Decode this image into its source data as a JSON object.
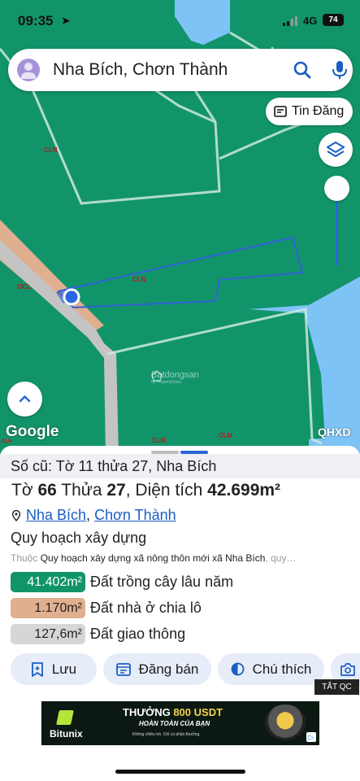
{
  "status_bar": {
    "time": "09:35",
    "network": "4G",
    "battery": "74"
  },
  "search": {
    "value": "Nha Bích, Chơn Thành"
  },
  "map": {
    "tin_dang_label": "Tin Đăng",
    "labels": {
      "cln_1": "CLN",
      "cln_2": "CLN",
      "cln_3": "CLN",
      "cln_4": "CLN",
      "ocl": "OCL",
      "cln_edge": "CLN"
    },
    "watermark": "Batdongsan",
    "watermark_sub": "by PropertyGuru",
    "google_logo": "Google",
    "layer_code": "QHXD"
  },
  "sheet": {
    "old_info": "Số cũ: Tờ 11 thửa 27, Nha Bích",
    "title": {
      "to_label": "Tờ",
      "to_value": "66",
      "thua_label": "Thửa",
      "thua_value": "27",
      "area_label": "Diện tích",
      "area_value": "42.699m²"
    },
    "location": {
      "commune": "Nha Bích",
      "separator": ",",
      "district": "Chơn Thành"
    },
    "planning_title": "Quy hoạch xây dựng",
    "planning_sub_prefix": "Thuộc",
    "planning_sub": "Quy hoạch xây dựng xã nông thôn mới xã Nha Bích",
    "planning_sub_suffix": ", quy…",
    "legend": [
      {
        "area": "41.402m²",
        "label": "Đất trồng cây lâu năm",
        "color": "#12946b",
        "text_color": "#ffffff"
      },
      {
        "area": "1.170m²",
        "label": "Đất nhà ở chia lô",
        "color": "#dfaf8f",
        "text_color": "#222222"
      },
      {
        "area": "127,6m²",
        "label": "Đất giao thông",
        "color": "#d6d6d6",
        "text_color": "#222222"
      }
    ],
    "actions": {
      "save": "Lưu",
      "post": "Đăng bán",
      "note": "Chú thích"
    },
    "ad_tag": "TẮT QC"
  },
  "ad": {
    "brand": "Bitunix",
    "headline_prefix": "THƯỞNG",
    "headline_amount": "800 USDT",
    "line2": "HOÀN TOÀN CỦA BẠN",
    "line3": "Không chiêu trò. Chỉ có phần thưởng."
  },
  "colors": {
    "land_green": "#12946b",
    "water_blue": "#7ec3f6",
    "accent_blue": "#1a5dc4",
    "road_orange": "#dfaf8f"
  }
}
